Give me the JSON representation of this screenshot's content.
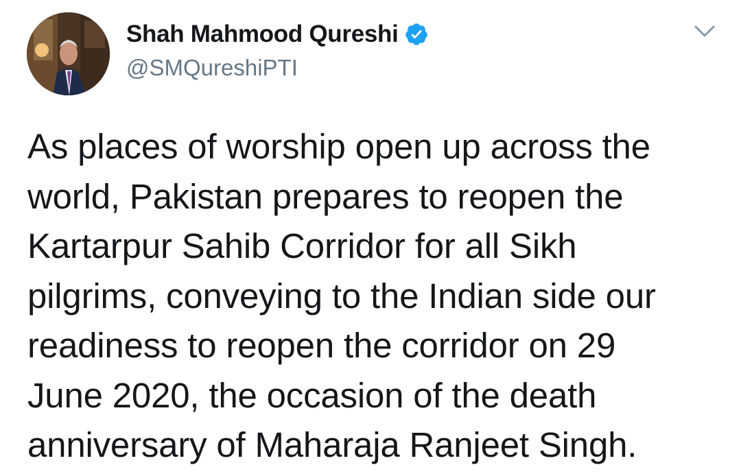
{
  "author": {
    "display_name": "Shah Mahmood Qureshi",
    "handle": "@SMQureshiPTI",
    "verified": true,
    "verified_color": "#1da1f2"
  },
  "menu": {
    "icon": "chevron-down-icon"
  },
  "tweet": {
    "lines": [
      "As places of worship open up across the",
      "world, Pakistan prepares to reopen the",
      "Kartarpur Sahib Corridor for all Sikh",
      "pilgrims, conveying to the Indian side our",
      "readiness to reopen the corridor on 29",
      "June 2020, the occasion of the death",
      "anniversary of Maharaja Ranjeet Singh."
    ]
  }
}
